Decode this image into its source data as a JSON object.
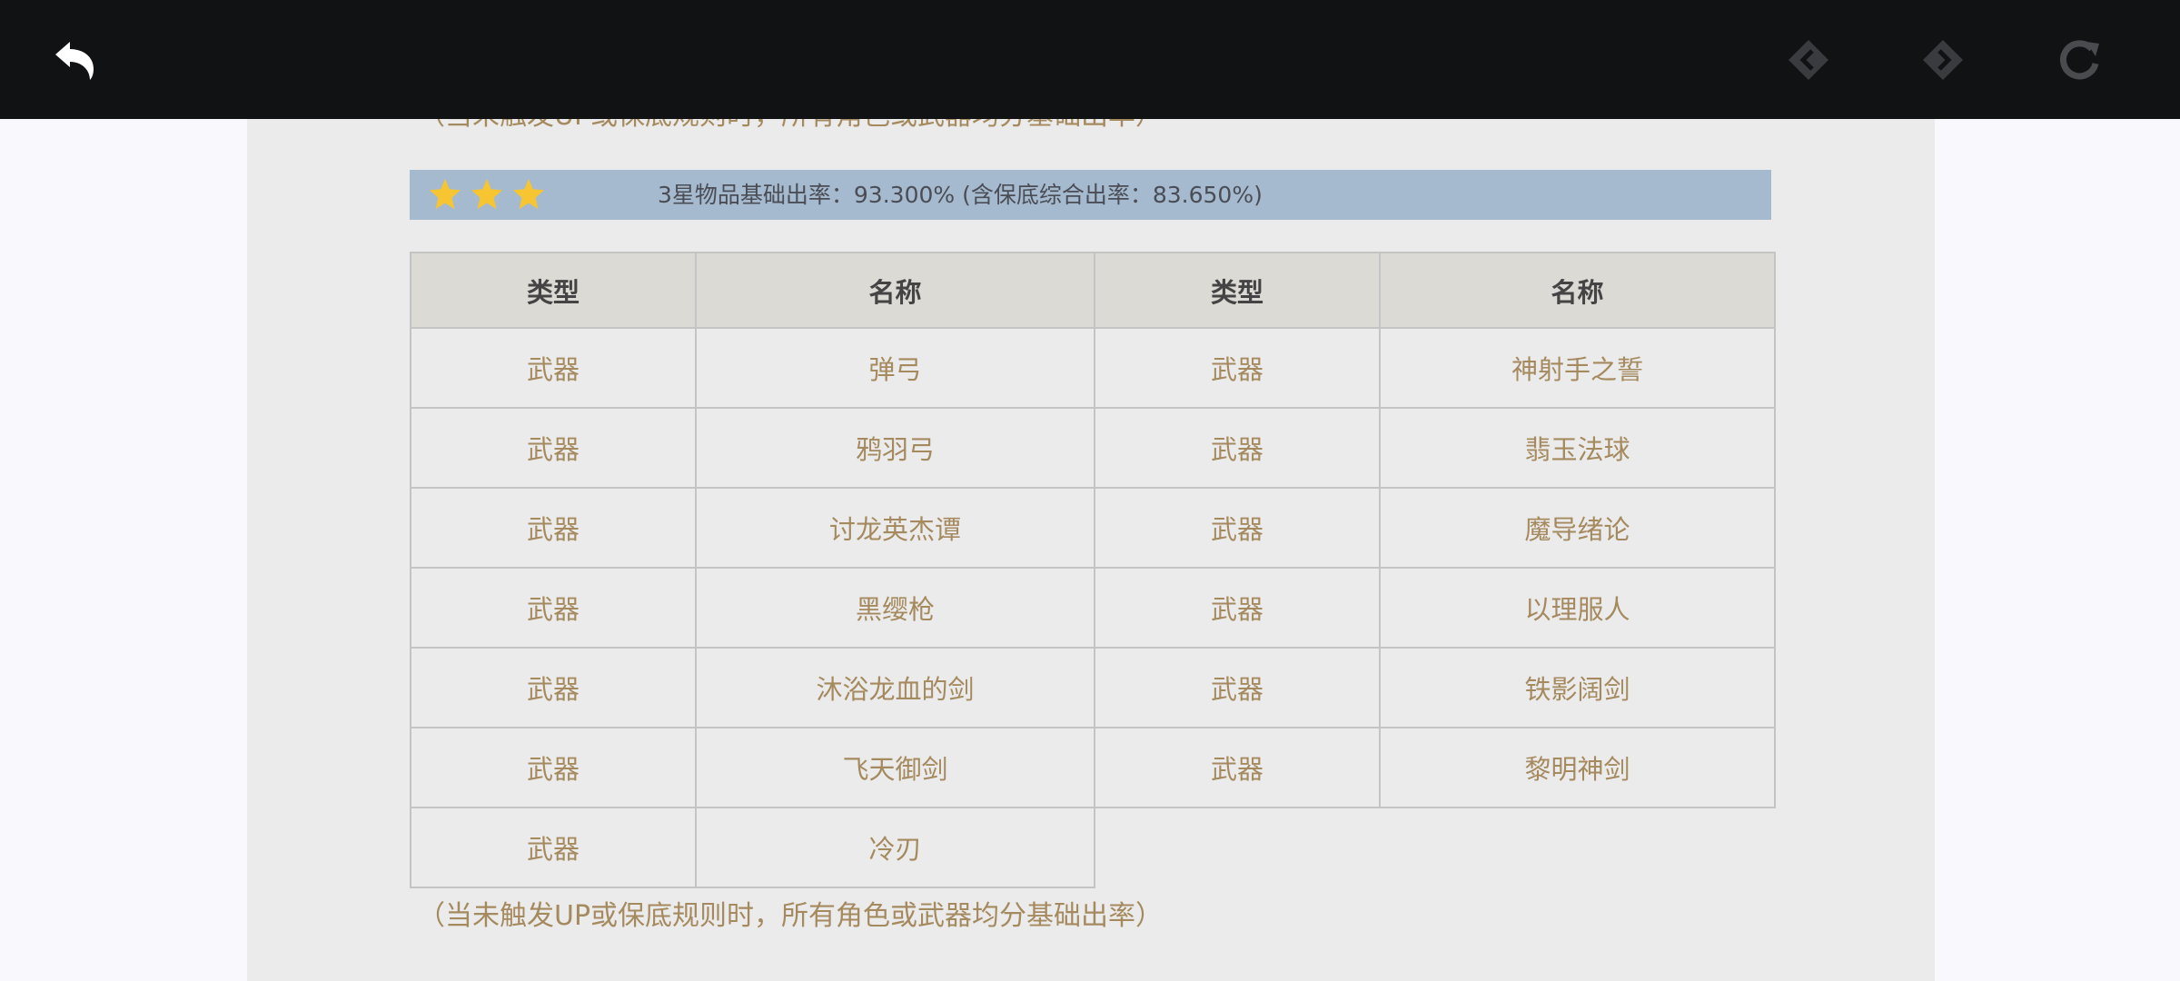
{
  "toolbar": {
    "back_icon": "back-arrow-icon",
    "prev_icon": "diamond-left-icon",
    "next_icon": "diamond-right-icon",
    "reload_icon": "reload-icon"
  },
  "content": {
    "note_top": "（当未触发UP或保底规则时，所有角色或武器均分基础出率）",
    "rate_bar": {
      "stars": 3,
      "text": "3星物品基础出率：93.300% (含保底综合出率：83.650%)"
    },
    "table": {
      "headers": [
        "类型",
        "名称",
        "类型",
        "名称"
      ],
      "rows": [
        [
          "武器",
          "弹弓",
          "武器",
          "神射手之誓"
        ],
        [
          "武器",
          "鸦羽弓",
          "武器",
          "翡玉法球"
        ],
        [
          "武器",
          "讨龙英杰谭",
          "武器",
          "魔导绪论"
        ],
        [
          "武器",
          "黑缨枪",
          "武器",
          "以理服人"
        ],
        [
          "武器",
          "沐浴龙血的剑",
          "武器",
          "铁影阔剑"
        ],
        [
          "武器",
          "飞天御剑",
          "武器",
          "黎明神剑"
        ],
        [
          "武器",
          "冷刃",
          "",
          ""
        ]
      ]
    },
    "note_bottom": "（当未触发UP或保底规则时，所有角色或武器均分基础出率）"
  },
  "colors": {
    "topbar": "#111214",
    "panel": "#ebebeb",
    "rate_bar": "#a6bacf",
    "gold_text": "#a68a5f",
    "star": "#f7c531"
  }
}
